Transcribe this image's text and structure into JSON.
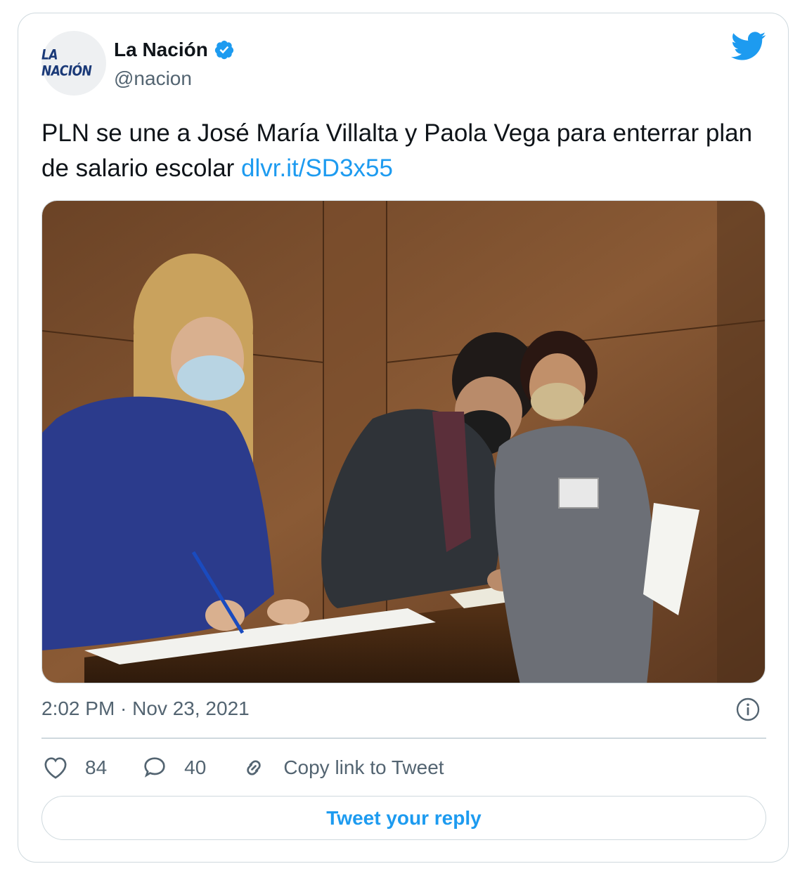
{
  "author": {
    "avatar_text": "LA NACIÓN",
    "name": "La Nación",
    "handle": "@nacion",
    "verified": true
  },
  "tweet": {
    "text": "PLN se une a José María Villalta y Paola Vega para enterrar plan de salario escolar",
    "link": "dlvr.it/SD3x55",
    "timestamp": "2:02 PM · Nov 23, 2021"
  },
  "actions": {
    "likes": "84",
    "replies": "40",
    "copy_link_label": "Copy link to Tweet"
  },
  "reply_button": "Tweet your reply",
  "icons": {
    "bird": "twitter-bird-icon",
    "verified": "verified-badge-icon",
    "info": "info-icon",
    "like": "heart-icon",
    "reply": "comment-icon",
    "copy": "link-icon"
  },
  "colors": {
    "accent": "#1d9bf0",
    "text": "#0f1419",
    "muted": "#536471",
    "border": "#cfd9de"
  }
}
